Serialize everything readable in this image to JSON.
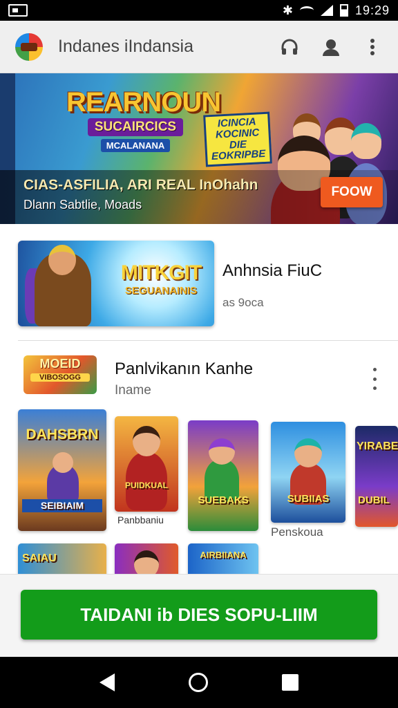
{
  "status_bar": {
    "time": "19:29",
    "icons": [
      "photo-icon",
      "bluetooth-icon",
      "wifi-icon",
      "signal-icon",
      "battery-icon"
    ]
  },
  "app_bar": {
    "title": "Indanes iIndansia",
    "actions": [
      "headset-icon",
      "account-icon",
      "more-vert-icon"
    ]
  },
  "banner": {
    "logo_line1": "REARNOUN",
    "logo_line2": "SUCAIRCICS",
    "logo_line3": "MCALANANA",
    "tag_line1": "ICINCIA",
    "tag_line2": "KOCINIC DIE",
    "tag_line3": "EOKRIPBE",
    "text": "CIAS-ASFILIA, ARI  REAL InOhahn",
    "subtext": "Dlann Sabtlie, Moads",
    "button": "FOOW"
  },
  "featured": {
    "thumb_title": "MITKGIT",
    "thumb_subtitle": "SEGUANAINIS",
    "title": "Anhnsia FiuC",
    "meta": "as 9oca"
  },
  "section": {
    "logo_text": "MOEID",
    "logo_sub": "VIBOSOGG",
    "title": "Panlvikanın Kanhe",
    "subtitle": "Iname",
    "cards": [
      {
        "title": "DAHSBRN",
        "subtitle": "SEIBIAIM"
      },
      {
        "title": "PUIDKUAL",
        "caption": "Panbbaniu"
      },
      {
        "title": "SUEBAKS"
      },
      {
        "title": "SUBIIAS",
        "label": "Penskoua"
      },
      {
        "title": "YIRABE",
        "subtitle": "DUBIL"
      },
      {
        "title": "SAIAU"
      },
      {
        "title": ""
      },
      {
        "title": "AIRBIIANA"
      }
    ]
  },
  "install": {
    "label": "TAIDANI ib DIES SOPU-LIIM"
  },
  "colors": {
    "install_green": "#139c1a",
    "banner_button": "#ef5a1f"
  }
}
